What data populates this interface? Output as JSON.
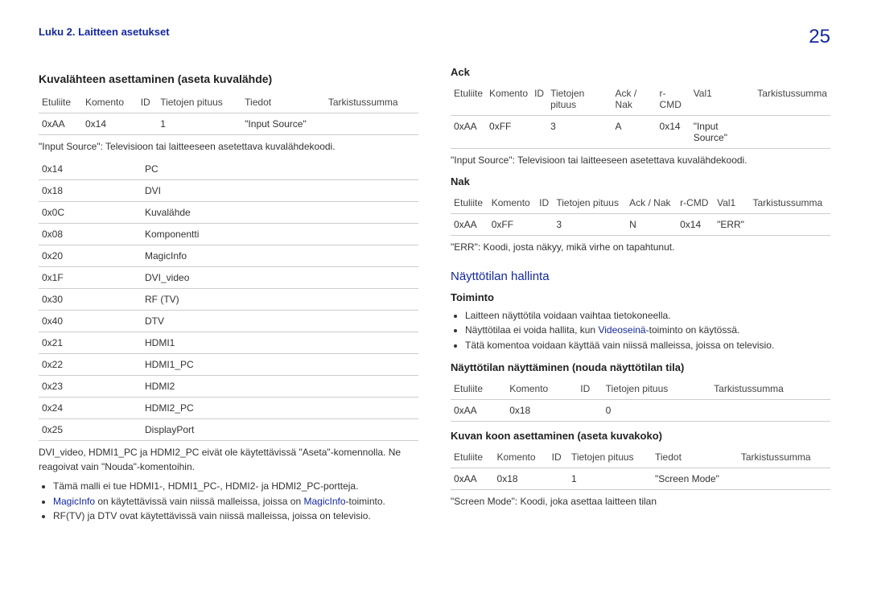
{
  "header": {
    "breadcrumb": "Luku 2. Laitteen asetukset",
    "page_number": "25"
  },
  "left": {
    "title": "Kuvalähteen asettaminen (aseta kuvalähde)",
    "table1": {
      "headers": [
        "Etuliite",
        "Komento",
        "ID",
        "Tietojen pituus",
        "Tiedot",
        "Tarkistussumma"
      ],
      "row": [
        "0xAA",
        "0x14",
        "",
        "1",
        "\"Input Source\"",
        ""
      ]
    },
    "note1": "\"Input Source\": Televisioon tai laitteeseen asetettava kuvalähdekoodi.",
    "codes": [
      [
        "0x14",
        "PC"
      ],
      [
        "0x18",
        "DVI"
      ],
      [
        "0x0C",
        "Kuvalähde"
      ],
      [
        "0x08",
        "Komponentti"
      ],
      [
        "0x20",
        "MagicInfo"
      ],
      [
        "0x1F",
        "DVI_video"
      ],
      [
        "0x30",
        "RF (TV)"
      ],
      [
        "0x40",
        "DTV"
      ],
      [
        "0x21",
        "HDMI1"
      ],
      [
        "0x22",
        "HDMI1_PC"
      ],
      [
        "0x23",
        "HDMI2"
      ],
      [
        "0x24",
        "HDMI2_PC"
      ],
      [
        "0x25",
        "DisplayPort"
      ]
    ],
    "note2": "DVI_video, HDMI1_PC ja HDMI2_PC eivät ole käytettävissä \"Aseta\"-komennolla. Ne reagoivat vain \"Nouda\"-komentoihin.",
    "bullets": {
      "b1": "Tämä malli ei tue HDMI1-, HDMI1_PC-, HDMI2- ja HDMI2_PC-portteja.",
      "b2_pre": "",
      "b2_link1": "MagicInfo",
      "b2_mid": " on käytettävissä vain niissä malleissa, joissa on ",
      "b2_link2": "MagicInfo",
      "b2_post": "-toiminto.",
      "b3": "RF(TV) ja DTV ovat käytettävissä vain niissä malleissa, joissa on televisio."
    }
  },
  "right": {
    "ack_title": "Ack",
    "ack_table": {
      "headers": [
        "Etuliite",
        "Komento",
        "ID",
        "Tietojen pituus",
        "Ack / Nak",
        "r-CMD",
        "Val1",
        "Tarkistussumma"
      ],
      "row": [
        "0xAA",
        "0xFF",
        "",
        "3",
        "A",
        "0x14",
        "\"Input Source\"",
        ""
      ]
    },
    "ack_note": "\"Input Source\": Televisioon tai laitteeseen asetettava kuvalähdekoodi.",
    "nak_title": "Nak",
    "nak_table": {
      "headers": [
        "Etuliite",
        "Komento",
        "ID",
        "Tietojen pituus",
        "Ack / Nak",
        "r-CMD",
        "Val1",
        "Tarkistussumma"
      ],
      "row": [
        "0xAA",
        "0xFF",
        "",
        "3",
        "N",
        "0x14",
        "\"ERR\"",
        ""
      ]
    },
    "nak_note": "\"ERR\": Koodi, josta näkyy, mikä virhe on tapahtunut.",
    "section2_title": "Näyttötilan hallinta",
    "toiminto_title": "Toiminto",
    "toiminto_bullets": {
      "b1": "Laitteen näyttötila voidaan vaihtaa tietokoneella.",
      "b2_pre": "Näyttötilaa ei voida hallita, kun ",
      "b2_link": "Videoseinä",
      "b2_post": "-toiminto on käytössä.",
      "b3": "Tätä komentoa voidaan käyttää vain niissä malleissa, joissa on televisio."
    },
    "get_title": "Näyttötilan näyttäminen (nouda näyttötilan tila)",
    "get_table": {
      "headers": [
        "Etuliite",
        "Komento",
        "ID",
        "Tietojen pituus",
        "Tarkistussumma"
      ],
      "row": [
        "0xAA",
        "0x18",
        "",
        "0",
        ""
      ]
    },
    "set_title": "Kuvan koon asettaminen (aseta kuvakoko)",
    "set_table": {
      "headers": [
        "Etuliite",
        "Komento",
        "ID",
        "Tietojen pituus",
        "Tiedot",
        "Tarkistussumma"
      ],
      "row": [
        "0xAA",
        "0x18",
        "",
        "1",
        "\"Screen Mode\"",
        ""
      ]
    },
    "set_note": "\"Screen Mode\": Koodi, joka asettaa laitteen tilan"
  }
}
